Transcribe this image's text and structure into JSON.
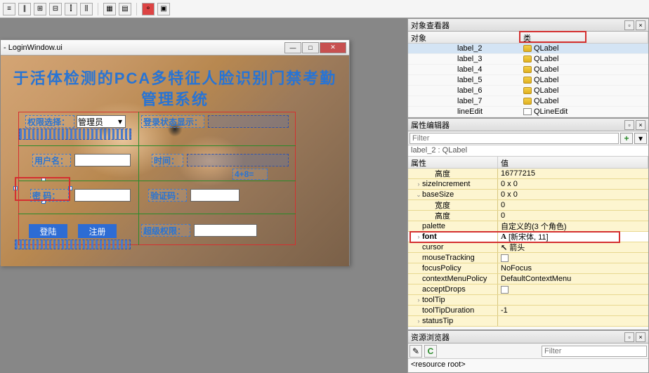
{
  "toolbar": {
    "icons": [
      "layout1",
      "layout2",
      "layout3",
      "layout4",
      "layout5",
      "break",
      "grid",
      "align",
      "gear",
      "db",
      "tool"
    ]
  },
  "designer": {
    "title": "- LoginWindow.ui",
    "form_title_line1": "于活体检测的PCA多特征人脸识别门禁考勤",
    "form_title_line2": "管理系统",
    "labels": {
      "role_select": "权限选择：",
      "role_value": "管理员",
      "login_status": "登录状态显示：",
      "username": "用户名：",
      "time": "时间：",
      "captcha": "4+8=",
      "password": "密 码：",
      "verify": "验证码：",
      "login": "登陆",
      "register": "注册",
      "super": "超级权限："
    }
  },
  "object_tree": {
    "title": "对象查看器",
    "hdr1": "对象",
    "hdr2": "类",
    "rows": [
      {
        "name": "label_2",
        "cls": "QLabel",
        "sel": true
      },
      {
        "name": "label_3",
        "cls": "QLabel"
      },
      {
        "name": "label_4",
        "cls": "QLabel"
      },
      {
        "name": "label_5",
        "cls": "QLabel"
      },
      {
        "name": "label_6",
        "cls": "QLabel"
      },
      {
        "name": "label_7",
        "cls": "QLabel"
      },
      {
        "name": "lineEdit",
        "cls": "QLineEdit",
        "le": true
      }
    ]
  },
  "props": {
    "title": "属性编辑器",
    "filter_ph": "Filter",
    "crumb": "label_2 : QLabel",
    "hdr1": "属性",
    "hdr2": "值",
    "rows": [
      {
        "k": "高度",
        "v": "16777215",
        "bg": "y",
        "ind": true
      },
      {
        "k": "sizeIncrement",
        "v": "0 x 0",
        "bg": "y",
        "exp": ">"
      },
      {
        "k": "baseSize",
        "v": "0 x 0",
        "bg": "y",
        "exp": "v"
      },
      {
        "k": "宽度",
        "v": "0",
        "bg": "y",
        "ind": true
      },
      {
        "k": "高度",
        "v": "0",
        "bg": "y",
        "ind": true
      },
      {
        "k": "palette",
        "v": "自定义的(3 个角色)",
        "bg": "y"
      },
      {
        "k": "font",
        "v": "[新宋体, 11]",
        "bg": "w",
        "exp": ">",
        "bold": true,
        "ico": "A"
      },
      {
        "k": "cursor",
        "v": "箭头",
        "bg": "y",
        "ico": "↖"
      },
      {
        "k": "mouseTracking",
        "v": "",
        "bg": "y",
        "chk": true
      },
      {
        "k": "focusPolicy",
        "v": "NoFocus",
        "bg": "y"
      },
      {
        "k": "contextMenuPolicy",
        "v": "DefaultContextMenu",
        "bg": "y"
      },
      {
        "k": "acceptDrops",
        "v": "",
        "bg": "y",
        "chk": true
      },
      {
        "k": "toolTip",
        "v": "",
        "bg": "y",
        "exp": ">"
      },
      {
        "k": "toolTipDuration",
        "v": "-1",
        "bg": "y"
      },
      {
        "k": "statusTip",
        "v": "",
        "bg": "y",
        "exp": ">"
      }
    ]
  },
  "resources": {
    "title": "资源浏览器",
    "filter_ph": "Filter",
    "root": "<resource root>"
  }
}
